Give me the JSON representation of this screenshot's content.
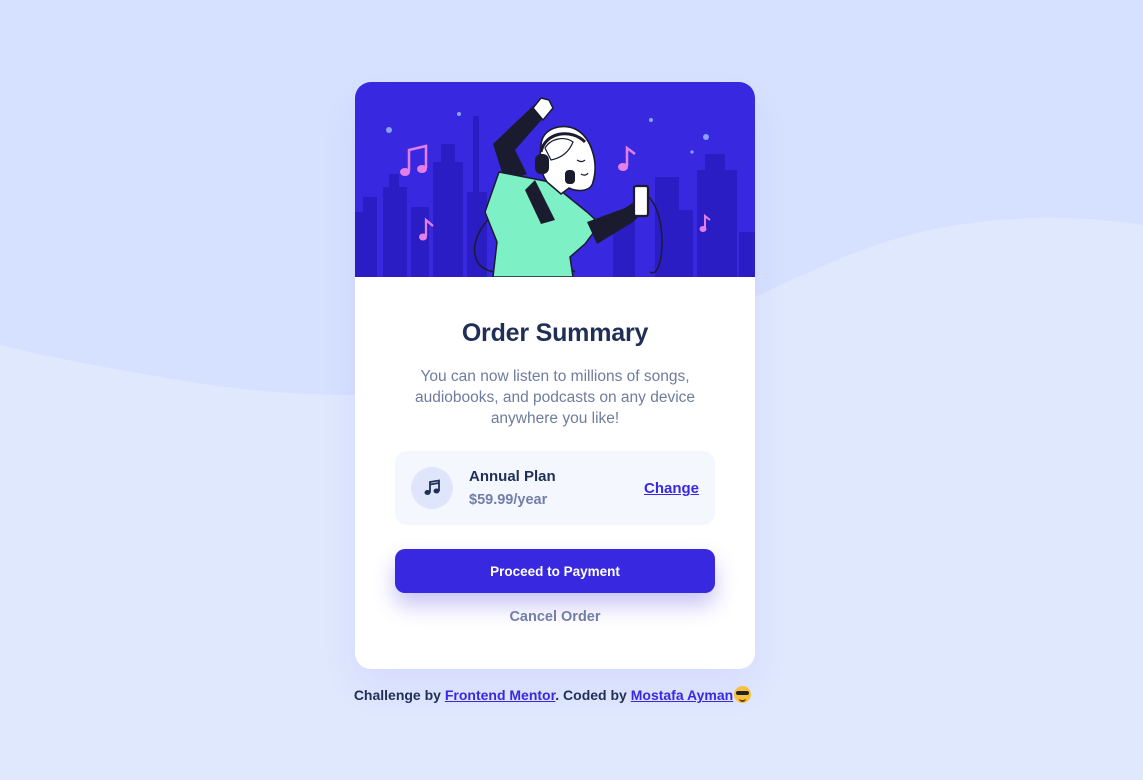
{
  "card": {
    "title": "Order Summary",
    "description": "You can now listen to millions of songs, audiobooks, and podcasts on any device anywhere you like!",
    "hero_illustration": "person-dancing-with-headphones-illustration"
  },
  "plan": {
    "icon": "music-note-icon",
    "name": "Annual Plan",
    "price": "$59.99/year",
    "change_label": "Change"
  },
  "actions": {
    "proceed_label": "Proceed to Payment",
    "cancel_label": "Cancel Order"
  },
  "footer": {
    "prefix": "Challenge by ",
    "mentor_link": "Frontend Mentor",
    "middle": ". Coded by ",
    "author_link": "Mostafa Ayman",
    "emoji": "smiling-face-with-sunglasses-icon"
  },
  "colors": {
    "background": "#e0e8fe",
    "accent": "#3829e0",
    "heading": "#1f2f56",
    "muted_text": "#717fa6",
    "plan_background": "#f5f7ff"
  }
}
